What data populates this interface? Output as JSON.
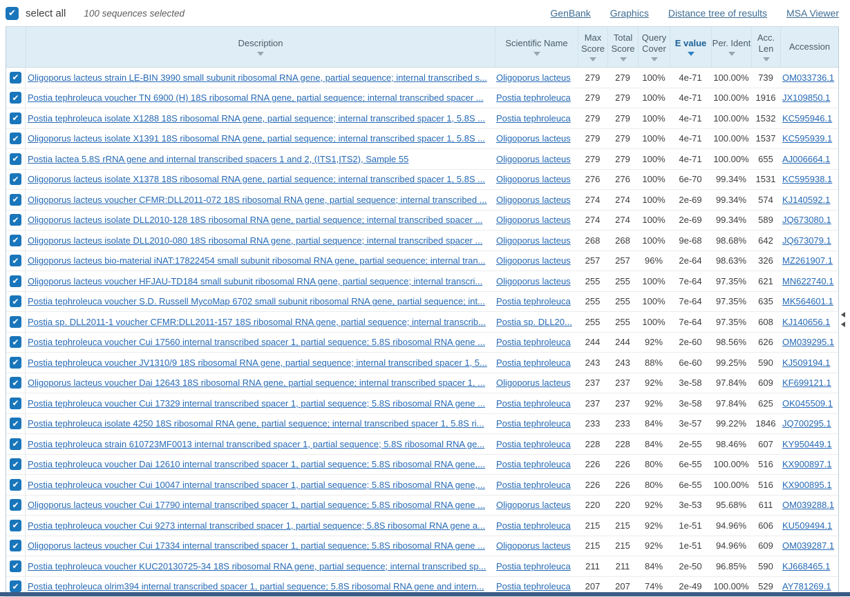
{
  "toolbar": {
    "select_all_label": "select all",
    "selection_status": "100 sequences selected",
    "links": [
      "GenBank",
      "Graphics",
      "Distance tree of results",
      "MSA Viewer"
    ]
  },
  "colors": {
    "checkbox_blue": "#1a76bb",
    "link_blue": "#2569b5",
    "header_bg": "#dfeef6",
    "header_text": "#4a5a68",
    "sorted_header_text": "#1d5f98",
    "sort_arrow_gray": "#9aa5ad",
    "sort_arrow_blue": "#2f80c3",
    "toolbar_link": "#3f6d93",
    "bottom_bar": "#3a5c86"
  },
  "table": {
    "columns": [
      {
        "label": "",
        "sort_arrow": false,
        "active": false
      },
      {
        "label": "Description",
        "sort_arrow": true,
        "active": false
      },
      {
        "label": "Scientific Name",
        "sort_arrow": true,
        "active": false
      },
      {
        "label": "Max Score",
        "sort_arrow": true,
        "active": false
      },
      {
        "label": "Total Score",
        "sort_arrow": true,
        "active": false
      },
      {
        "label": "Query Cover",
        "sort_arrow": true,
        "active": false
      },
      {
        "label": "E value",
        "sort_arrow": true,
        "active": true
      },
      {
        "label": "Per. Ident",
        "sort_arrow": true,
        "active": false
      },
      {
        "label": "Acc. Len",
        "sort_arrow": true,
        "active": false
      },
      {
        "label": "Accession",
        "sort_arrow": false,
        "active": false
      }
    ],
    "rows": [
      {
        "checked": true,
        "description": "Oligoporus lacteus strain LE-BIN 3990 small subunit ribosomal RNA gene, partial sequence; internal transcribed s...",
        "scientific_name": "Oligoporus lacteus",
        "max_score": "279",
        "total_score": "279",
        "query_cover": "100%",
        "e_value": "4e-71",
        "per_ident": "100.00%",
        "acc_len": "739",
        "accession": "OM033736.1"
      },
      {
        "checked": true,
        "description": "Postia tephroleuca voucher TN 6900 (H) 18S ribosomal RNA gene, partial sequence; internal transcribed spacer ...",
        "scientific_name": "Postia tephroleuca",
        "max_score": "279",
        "total_score": "279",
        "query_cover": "100%",
        "e_value": "4e-71",
        "per_ident": "100.00%",
        "acc_len": "1916",
        "accession": "JX109850.1"
      },
      {
        "checked": true,
        "description": "Postia tephroleuca isolate X1288 18S ribosomal RNA gene, partial sequence; internal transcribed spacer 1, 5.8S ...",
        "scientific_name": "Postia tephroleuca",
        "max_score": "279",
        "total_score": "279",
        "query_cover": "100%",
        "e_value": "4e-71",
        "per_ident": "100.00%",
        "acc_len": "1532",
        "accession": "KC595946.1"
      },
      {
        "checked": true,
        "description": "Oligoporus lacteus isolate X1391 18S ribosomal RNA gene, partial sequence; internal transcribed spacer 1, 5.8S ...",
        "scientific_name": "Oligoporus lacteus",
        "max_score": "279",
        "total_score": "279",
        "query_cover": "100%",
        "e_value": "4e-71",
        "per_ident": "100.00%",
        "acc_len": "1537",
        "accession": "KC595939.1"
      },
      {
        "checked": true,
        "description": "Postia lactea 5.8S rRNA gene and internal transcribed spacers 1 and 2, (ITS1,ITS2), Sample 55",
        "scientific_name": "Oligoporus lacteus",
        "max_score": "279",
        "total_score": "279",
        "query_cover": "100%",
        "e_value": "4e-71",
        "per_ident": "100.00%",
        "acc_len": "655",
        "accession": "AJ006664.1"
      },
      {
        "checked": true,
        "description": "Oligoporus lacteus isolate X1378 18S ribosomal RNA gene, partial sequence; internal transcribed spacer 1, 5.8S ...",
        "scientific_name": "Oligoporus lacteus",
        "max_score": "276",
        "total_score": "276",
        "query_cover": "100%",
        "e_value": "6e-70",
        "per_ident": "99.34%",
        "acc_len": "1531",
        "accession": "KC595938.1"
      },
      {
        "checked": true,
        "description": "Oligoporus lacteus voucher CFMR:DLL2011-072 18S ribosomal RNA gene, partial sequence; internal transcribed ...",
        "scientific_name": "Oligoporus lacteus",
        "max_score": "274",
        "total_score": "274",
        "query_cover": "100%",
        "e_value": "2e-69",
        "per_ident": "99.34%",
        "acc_len": "574",
        "accession": "KJ140592.1"
      },
      {
        "checked": true,
        "description": "Oligoporus lacteus isolate DLL2010-128 18S ribosomal RNA gene, partial sequence; internal transcribed spacer ...",
        "scientific_name": "Oligoporus lacteus",
        "max_score": "274",
        "total_score": "274",
        "query_cover": "100%",
        "e_value": "2e-69",
        "per_ident": "99.34%",
        "acc_len": "589",
        "accession": "JQ673080.1"
      },
      {
        "checked": true,
        "description": "Oligoporus lacteus isolate DLL2010-080 18S ribosomal RNA gene, partial sequence; internal transcribed spacer ...",
        "scientific_name": "Oligoporus lacteus",
        "max_score": "268",
        "total_score": "268",
        "query_cover": "100%",
        "e_value": "9e-68",
        "per_ident": "98.68%",
        "acc_len": "642",
        "accession": "JQ673079.1"
      },
      {
        "checked": true,
        "description": "Oligoporus lacteus bio-material iNAT:17822454 small subunit ribosomal RNA gene, partial sequence; internal tran...",
        "scientific_name": "Oligoporus lacteus",
        "max_score": "257",
        "total_score": "257",
        "query_cover": "96%",
        "e_value": "2e-64",
        "per_ident": "98.63%",
        "acc_len": "326",
        "accession": "MZ261907.1"
      },
      {
        "checked": true,
        "description": "Oligoporus lacteus voucher HFJAU-TD184 small subunit ribosomal RNA gene, partial sequence; internal transcri...",
        "scientific_name": "Oligoporus lacteus",
        "max_score": "255",
        "total_score": "255",
        "query_cover": "100%",
        "e_value": "7e-64",
        "per_ident": "97.35%",
        "acc_len": "621",
        "accession": "MN622740.1"
      },
      {
        "checked": true,
        "description": "Postia tephroleuca voucher S.D. Russell MycoMap 6702 small subunit ribosomal RNA gene, partial sequence; int...",
        "scientific_name": "Postia tephroleuca",
        "max_score": "255",
        "total_score": "255",
        "query_cover": "100%",
        "e_value": "7e-64",
        "per_ident": "97.35%",
        "acc_len": "635",
        "accession": "MK564601.1"
      },
      {
        "checked": true,
        "description": "Postia sp. DLL2011-1 voucher CFMR:DLL2011-157 18S ribosomal RNA gene, partial sequence; internal transcrib...",
        "scientific_name": "Postia sp. DLL20...",
        "max_score": "255",
        "total_score": "255",
        "query_cover": "100%",
        "e_value": "7e-64",
        "per_ident": "97.35%",
        "acc_len": "608",
        "accession": "KJ140656.1"
      },
      {
        "checked": true,
        "description": "Postia tephroleuca voucher Cui 17560 internal transcribed spacer 1, partial sequence; 5.8S ribosomal RNA gene ...",
        "scientific_name": "Postia tephroleuca",
        "max_score": "244",
        "total_score": "244",
        "query_cover": "92%",
        "e_value": "2e-60",
        "per_ident": "98.56%",
        "acc_len": "626",
        "accession": "OM039295.1"
      },
      {
        "checked": true,
        "description": "Postia tephroleuca voucher JV1310/9 18S ribosomal RNA gene, partial sequence; internal transcribed spacer 1, 5...",
        "scientific_name": "Postia tephroleuca",
        "max_score": "243",
        "total_score": "243",
        "query_cover": "88%",
        "e_value": "6e-60",
        "per_ident": "99.25%",
        "acc_len": "590",
        "accession": "KJ509194.1"
      },
      {
        "checked": true,
        "description": "Oligoporus lacteus voucher Dai 12643 18S ribosomal RNA gene, partial sequence; internal transcribed spacer 1, ...",
        "scientific_name": "Oligoporus lacteus",
        "max_score": "237",
        "total_score": "237",
        "query_cover": "92%",
        "e_value": "3e-58",
        "per_ident": "97.84%",
        "acc_len": "609",
        "accession": "KF699121.1"
      },
      {
        "checked": true,
        "description": "Postia tephroleuca voucher Cui 17329 internal transcribed spacer 1, partial sequence; 5.8S ribosomal RNA gene ...",
        "scientific_name": "Postia tephroleuca",
        "max_score": "237",
        "total_score": "237",
        "query_cover": "92%",
        "e_value": "3e-58",
        "per_ident": "97.84%",
        "acc_len": "625",
        "accession": "OK045509.1"
      },
      {
        "checked": true,
        "description": "Postia tephroleuca isolate 4250 18S ribosomal RNA gene, partial sequence; internal transcribed spacer 1, 5.8S ri...",
        "scientific_name": "Postia tephroleuca",
        "max_score": "233",
        "total_score": "233",
        "query_cover": "84%",
        "e_value": "3e-57",
        "per_ident": "99.22%",
        "acc_len": "1846",
        "accession": "JQ700295.1"
      },
      {
        "checked": true,
        "description": "Postia tephroleuca strain 610723MF0013 internal transcribed spacer 1, partial sequence; 5.8S ribosomal RNA ge...",
        "scientific_name": "Postia tephroleuca",
        "max_score": "228",
        "total_score": "228",
        "query_cover": "84%",
        "e_value": "2e-55",
        "per_ident": "98.46%",
        "acc_len": "607",
        "accession": "KY950449.1"
      },
      {
        "checked": true,
        "description": "Postia tephroleuca voucher Dai 12610 internal transcribed spacer 1, partial sequence; 5.8S ribosomal RNA gene,...",
        "scientific_name": "Postia tephroleuca",
        "max_score": "226",
        "total_score": "226",
        "query_cover": "80%",
        "e_value": "6e-55",
        "per_ident": "100.00%",
        "acc_len": "516",
        "accession": "KX900897.1"
      },
      {
        "checked": true,
        "description": "Postia tephroleuca voucher Cui 10047 internal transcribed spacer 1, partial sequence; 5.8S ribosomal RNA gene,...",
        "scientific_name": "Postia tephroleuca",
        "max_score": "226",
        "total_score": "226",
        "query_cover": "80%",
        "e_value": "6e-55",
        "per_ident": "100.00%",
        "acc_len": "516",
        "accession": "KX900895.1"
      },
      {
        "checked": true,
        "description": "Oligoporus lacteus voucher Cui 17790 internal transcribed spacer 1, partial sequence; 5.8S ribosomal RNA gene ...",
        "scientific_name": "Oligoporus lacteus",
        "max_score": "220",
        "total_score": "220",
        "query_cover": "92%",
        "e_value": "3e-53",
        "per_ident": "95.68%",
        "acc_len": "611",
        "accession": "OM039288.1"
      },
      {
        "checked": true,
        "description": "Postia tephroleuca voucher Cui 9273 internal transcribed spacer 1, partial sequence; 5.8S ribosomal RNA gene a...",
        "scientific_name": "Postia tephroleuca",
        "max_score": "215",
        "total_score": "215",
        "query_cover": "92%",
        "e_value": "1e-51",
        "per_ident": "94.96%",
        "acc_len": "606",
        "accession": "KU509494.1"
      },
      {
        "checked": true,
        "description": "Oligoporus lacteus voucher Cui 17334 internal transcribed spacer 1, partial sequence; 5.8S ribosomal RNA gene ...",
        "scientific_name": "Oligoporus lacteus",
        "max_score": "215",
        "total_score": "215",
        "query_cover": "92%",
        "e_value": "1e-51",
        "per_ident": "94.96%",
        "acc_len": "609",
        "accession": "OM039287.1"
      },
      {
        "checked": true,
        "description": "Postia tephroleuca voucher KUC20130725-34 18S ribosomal RNA gene, partial sequence; internal transcribed sp...",
        "scientific_name": "Postia tephroleuca",
        "max_score": "211",
        "total_score": "211",
        "query_cover": "84%",
        "e_value": "2e-50",
        "per_ident": "96.85%",
        "acc_len": "590",
        "accession": "KJ668465.1"
      },
      {
        "checked": true,
        "description": "Postia tephroleuca olrim394 internal transcribed spacer 1, partial sequence; 5.8S ribosomal RNA gene and intern...",
        "scientific_name": "Postia tephroleuca",
        "max_score": "207",
        "total_score": "207",
        "query_cover": "74%",
        "e_value": "2e-49",
        "per_ident": "100.00%",
        "acc_len": "529",
        "accession": "AY781269.1"
      }
    ]
  }
}
